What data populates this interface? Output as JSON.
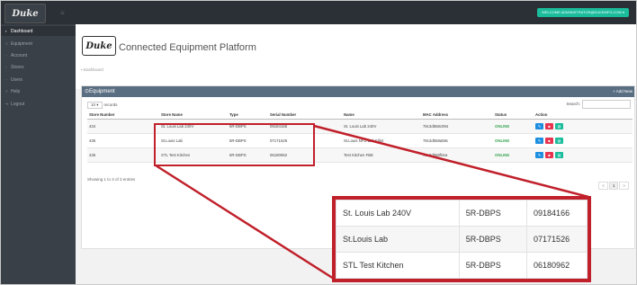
{
  "topbar": {
    "logo_text": "Duke",
    "welcome": "WELCOME  ADMINISTRATOR@DUKEMFG.COM ▾"
  },
  "sidebar": {
    "items": [
      {
        "label": "Dashboard",
        "icon": "dashboard-icon"
      },
      {
        "label": "Equipment",
        "icon": "equipment-icon"
      },
      {
        "label": "Account",
        "icon": "account-icon"
      },
      {
        "label": "Stores",
        "icon": "stores-icon"
      },
      {
        "label": "Users",
        "icon": "users-icon"
      },
      {
        "label": "Help",
        "icon": "help-icon"
      },
      {
        "label": "Logout",
        "icon": "logout-icon"
      }
    ]
  },
  "header": {
    "logo_text": "Duke",
    "title": "Connected Equipment Platform",
    "breadcrumb": "Dashboard"
  },
  "panel": {
    "title": "Equipment",
    "add_new": "+ Add New",
    "length_value": "10",
    "length_suffix": "records",
    "search_label": "Search:",
    "columns": [
      "Store Number",
      "Store Name",
      "Type",
      "Serial Number",
      "Name",
      "MAC Address",
      "Status",
      "Action"
    ],
    "rows": [
      {
        "store_number": "434",
        "store_name": "St. Louis Lab 240V",
        "type": "5R-DBPS",
        "serial": "09184166",
        "name": "St. Louis Lab 240V",
        "mac": "78c3d558c094",
        "status": "ONLINE"
      },
      {
        "store_number": "435",
        "store_name": "St.Louis Lab",
        "type": "5R-DBPS",
        "serial": "07171526",
        "name": "St.Louis NFD Lab Fillet",
        "mac": "78c3d558a59c",
        "status": "ONLINE"
      },
      {
        "store_number": "436",
        "store_name": "STL Test Kitchen",
        "type": "5R-DBPS",
        "serial": "06180962",
        "name": "Test Kitchen FBE",
        "mac": "78c3d558f0ea",
        "status": "ONLINE"
      }
    ],
    "showing": "Showing 1 to 3 of 3 entries",
    "pager": [
      "<",
      "1",
      ">"
    ]
  },
  "zoom": {
    "rows": [
      {
        "store_name": "St. Louis Lab 240V",
        "type": "5R-DBPS",
        "serial": "09184166"
      },
      {
        "store_name": "St.Louis Lab",
        "type": "5R-DBPS",
        "serial": "07171526"
      },
      {
        "store_name": "STL Test Kitchen",
        "type": "5R-DBPS",
        "serial": "06180962"
      }
    ]
  },
  "colors": {
    "highlight": "#c0202a",
    "accent": "#1abc9c",
    "panel_header": "#5a6e82",
    "sidebar": "#3a4047"
  }
}
